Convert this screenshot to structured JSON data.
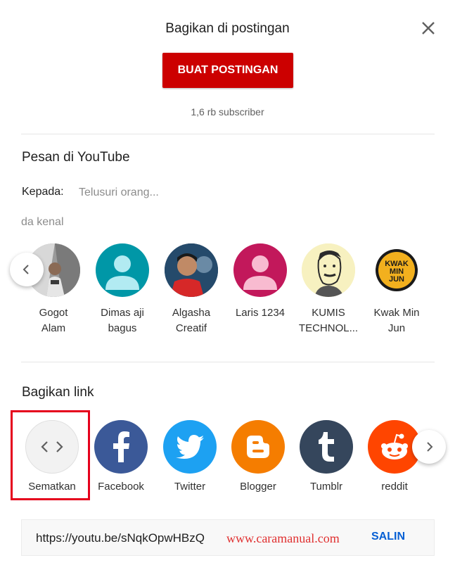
{
  "dialog": {
    "title": "Bagikan di postingan",
    "create_post_button": "BUAT POSTINGAN",
    "subscriber_count": "1,6 rb subscriber"
  },
  "message": {
    "section_title": "Pesan di YouTube",
    "to_label": "Kepada:",
    "search_placeholder": "Telusuri orang...",
    "known_label": "da kenal",
    "contacts": [
      {
        "name_line1": "Gogot",
        "name_line2": "Alam"
      },
      {
        "name_line1": "Dimas aji",
        "name_line2": "bagus"
      },
      {
        "name_line1": "Algasha",
        "name_line2": "Creatif"
      },
      {
        "name_line1": "Laris 1234",
        "name_line2": ""
      },
      {
        "name_line1": "KUMIS",
        "name_line2": "TECHNOL..."
      },
      {
        "name_line1": "Kwak Min",
        "name_line2": "Jun"
      }
    ],
    "avatar_text": {
      "kwak": "KWAK MIN JUN"
    }
  },
  "share": {
    "section_title": "Bagikan link",
    "targets": [
      {
        "label": "Sematkan",
        "icon": "embed-icon",
        "color": "#f2f2f2"
      },
      {
        "label": "Facebook",
        "icon": "facebook-icon",
        "color": "#3b5998"
      },
      {
        "label": "Twitter",
        "icon": "twitter-icon",
        "color": "#1da1f2"
      },
      {
        "label": "Blogger",
        "icon": "blogger-icon",
        "color": "#f57d00"
      },
      {
        "label": "Tumblr",
        "icon": "tumblr-icon",
        "color": "#35465c"
      },
      {
        "label": "reddit",
        "icon": "reddit-icon",
        "color": "#ff4500"
      }
    ],
    "url": "https://youtu.be/sNqkOpwHBzQ",
    "watermark": "www.caramanual.com",
    "copy_button": "SALIN"
  },
  "colors": {
    "accent_red": "#cc0000",
    "link_blue": "#065fd4",
    "highlight_red": "#e5001c"
  }
}
